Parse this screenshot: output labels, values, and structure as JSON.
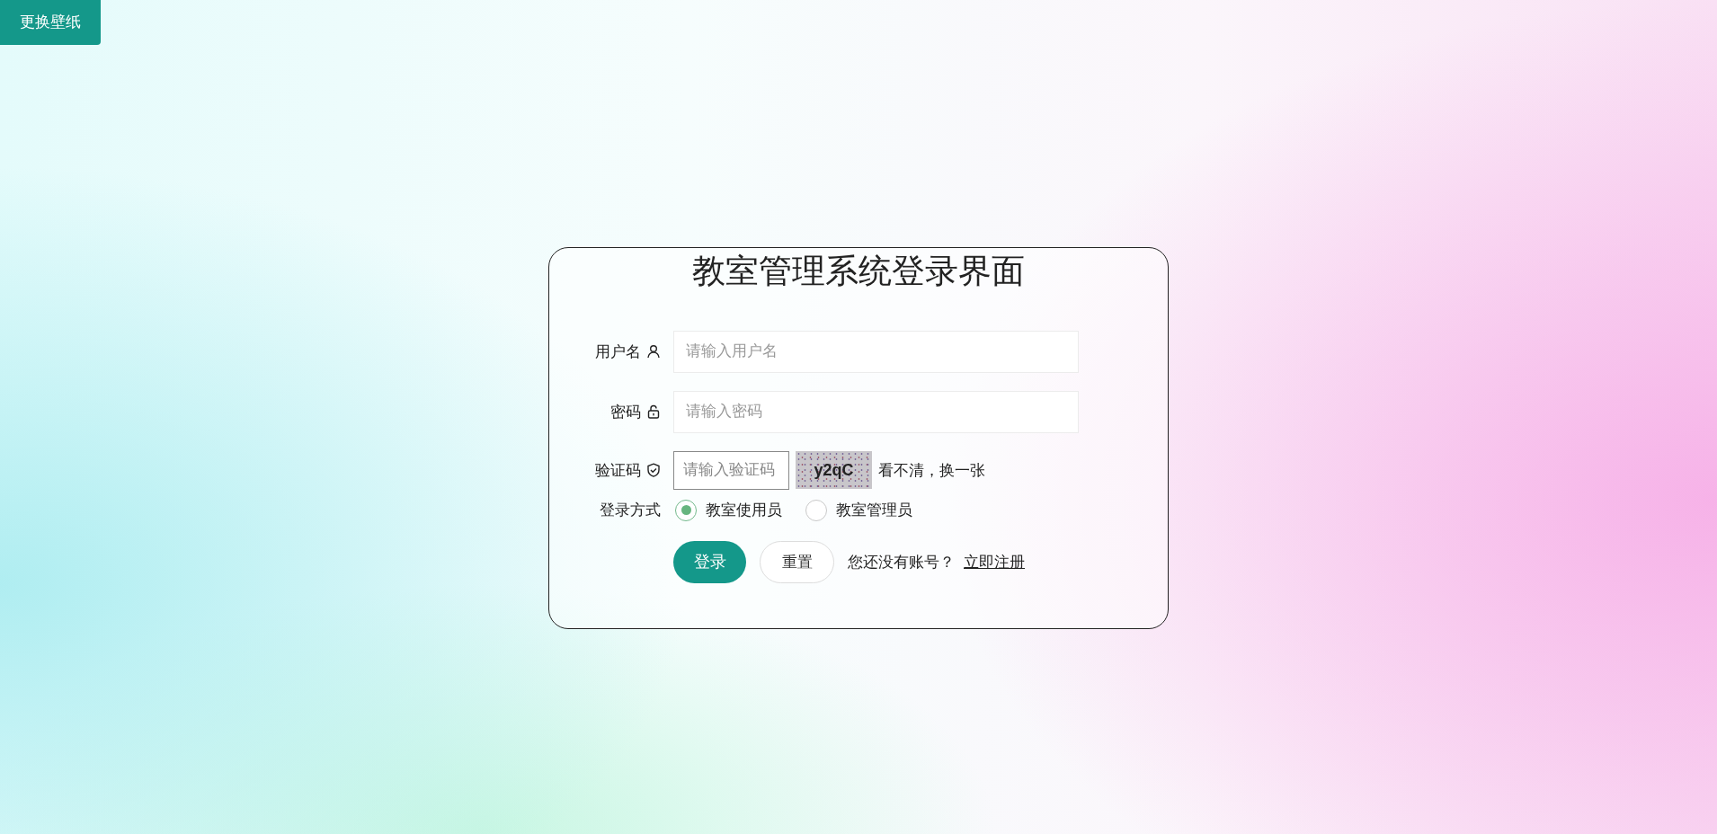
{
  "wallpaper_button": "更换壁纸",
  "title": "教室管理系统登录界面",
  "fields": [
    {
      "label": "用户名",
      "placeholder": "请输入用户名",
      "kind": "user"
    },
    {
      "label": "密码",
      "placeholder": "请输入密码",
      "kind": "lock"
    }
  ],
  "captcha": {
    "label": "验证码",
    "placeholder": "请输入验证码",
    "code": "y2qC",
    "refresh": "看不清，换一张"
  },
  "login_mode": {
    "label": "登录方式",
    "options": [
      {
        "label": "教室使用员",
        "selected": true
      },
      {
        "label": "教室管理员",
        "selected": false
      }
    ]
  },
  "buttons": {
    "login": "登录",
    "reset": "重置"
  },
  "register": {
    "prompt": "您还没有账号？",
    "link": "立即注册"
  }
}
